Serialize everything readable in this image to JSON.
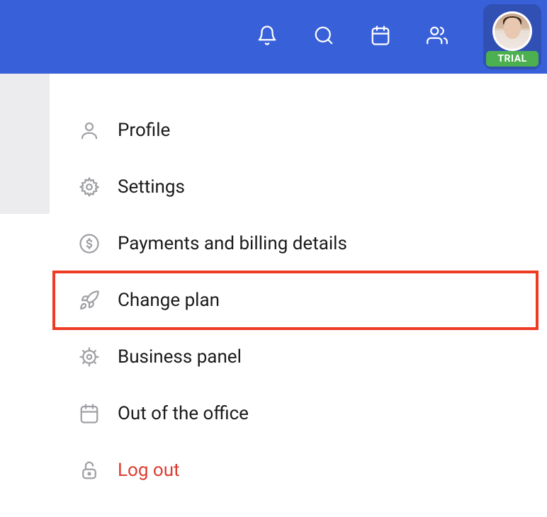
{
  "header": {
    "badge": "TRIAL"
  },
  "menu": {
    "items": [
      {
        "id": "profile",
        "label": "Profile",
        "icon": "person-icon"
      },
      {
        "id": "settings",
        "label": "Settings",
        "icon": "gear-icon"
      },
      {
        "id": "payments",
        "label": "Payments and billing details",
        "icon": "dollar-circle-icon"
      },
      {
        "id": "change-plan",
        "label": "Change plan",
        "icon": "rocket-icon"
      },
      {
        "id": "business-panel",
        "label": "Business panel",
        "icon": "helm-icon"
      },
      {
        "id": "out-of-office",
        "label": "Out of the office",
        "icon": "calendar-icon"
      },
      {
        "id": "logout",
        "label": "Log out",
        "icon": "lock-icon"
      }
    ],
    "highlighted_index": 3
  },
  "colors": {
    "header_bg": "#3860d8",
    "avatar_container_bg": "#3150b4",
    "badge_bg": "#4caf50",
    "highlight_border": "#ee3b24",
    "logout_color": "#dc3c31",
    "icon_gray": "#9fa0a4"
  }
}
